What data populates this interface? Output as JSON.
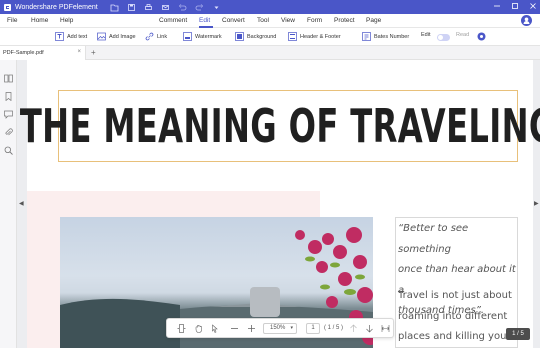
{
  "titlebar": {
    "app_name": "Wondershare PDFelement",
    "icons": [
      "folder-icon",
      "save-icon",
      "print-icon",
      "mail-icon",
      "undo-icon",
      "redo-icon",
      "dropdown-icon"
    ],
    "window_controls": [
      "minimize-icon",
      "maximize-icon",
      "close-icon"
    ]
  },
  "menu": {
    "left": [
      "File",
      "Home",
      "Help"
    ],
    "main": [
      "Comment",
      "Edit",
      "Convert",
      "Tool",
      "View",
      "Form",
      "Protect",
      "Page"
    ],
    "active": "Edit"
  },
  "toolbar": {
    "add_text": "Add text",
    "add_image": "Add Image",
    "link": "Link",
    "watermark": "Watermark",
    "background": "Background",
    "header_footer": "Header & Footer",
    "bates_number": "Bates Number",
    "edit": "Edit",
    "read": "Read",
    "accent": "#4a56c8"
  },
  "tabs": {
    "file_name": "PDF-Sample.pdf",
    "close": "×",
    "add": "+"
  },
  "document": {
    "title": "THE MEANING OF TRAVELING",
    "quote_lines": [
      "“Better to see something",
      "once than hear about it a",
      "thousand times”."
    ],
    "body_lines": [
      "Travel is not just about",
      "roaming into different",
      "places and killing your"
    ]
  },
  "zoom": {
    "level": "150%",
    "page_input": "1",
    "page_total": "( 1 / 5 )"
  },
  "page_counter": "1 / 5"
}
